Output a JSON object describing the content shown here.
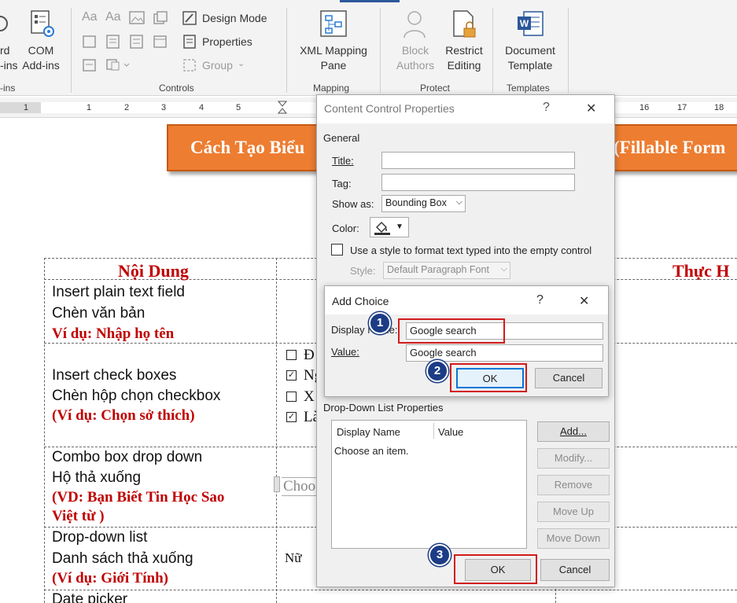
{
  "ribbon": {
    "left_partial": [
      "rd",
      "-ins"
    ],
    "com_addins": [
      "COM",
      "Add-ins"
    ],
    "addins_group_partial": "-ins",
    "design_mode": "Design Mode",
    "properties": "Properties",
    "group": "Group",
    "controls_label": "Controls",
    "xml_mapping": [
      "XML Mapping",
      "Pane"
    ],
    "mapping_label": "Mapping",
    "block_authors": [
      "Block",
      "Authors"
    ],
    "restrict_editing": [
      "Restrict",
      "Editing"
    ],
    "protect_label": "Protect",
    "document_template": [
      "Document",
      "Template"
    ],
    "templates_label": "Templates"
  },
  "ruler": {
    "left_numbers": [
      "1",
      "1",
      "2",
      "3",
      "4",
      "5"
    ],
    "right_numbers": [
      "16",
      "17",
      "18"
    ]
  },
  "document": {
    "banner_left": "Cách Tạo Biểu",
    "banner_right": "(Fillable Form",
    "header_left": "Nội Dung",
    "header_right": "Thực H",
    "row1": [
      "Insert plain text field",
      "Chèn văn bản",
      "Ví dụ: Nhập họ tên"
    ],
    "row2": [
      "Insert check boxes",
      "Chèn hộp chọn checkbox",
      "(Ví dụ: Chọn sở thích)"
    ],
    "row2_checks": [
      "Đ",
      "Ng",
      "X",
      "Là"
    ],
    "row3": [
      "Combo box drop down",
      "Hộ thả xuống",
      "(VD: Bạn Biết Tin Học Sao",
      "Việt từ )"
    ],
    "row3_combo": "Choo",
    "row4": [
      "Drop-down list",
      "Danh sách thả xuống",
      "(Ví dụ: Giới Tính)"
    ],
    "row4_value": "Nữ",
    "row5": "Date picker"
  },
  "ccp": {
    "title": "Content Control Properties",
    "help": "?",
    "close": "✕",
    "general": "General",
    "title_label": "Title:",
    "tag_label": "Tag:",
    "show_as_label": "Show as:",
    "show_as_value": "Bounding Box",
    "color_label": "Color:",
    "use_style": "Use a style to format text typed into the empty control",
    "style_label": "Style:",
    "style_value": "Default Paragraph Font",
    "ddl_props": "Drop-Down List Properties",
    "col_display": "Display Name",
    "col_value": "Value",
    "item1": "Choose an item.",
    "add": "Add...",
    "modify": "Modify...",
    "remove": "Remove",
    "move_up": "Move Up",
    "move_down": "Move Down",
    "ok": "OK",
    "cancel": "Cancel"
  },
  "add_choice": {
    "title": "Add Choice",
    "help": "?",
    "close": "✕",
    "display_label": "Display Name:",
    "display_value": "Google search",
    "value_label": "Value:",
    "value_value": "Google search",
    "ok": "OK",
    "cancel": "Cancel"
  },
  "badges": [
    "1",
    "2",
    "3"
  ],
  "colors": {
    "accent": "#2b579a",
    "annotation": "#d11b1b",
    "badge": "#1c3c86",
    "banner": "#ed7d31",
    "doc_red": "#c00000"
  }
}
